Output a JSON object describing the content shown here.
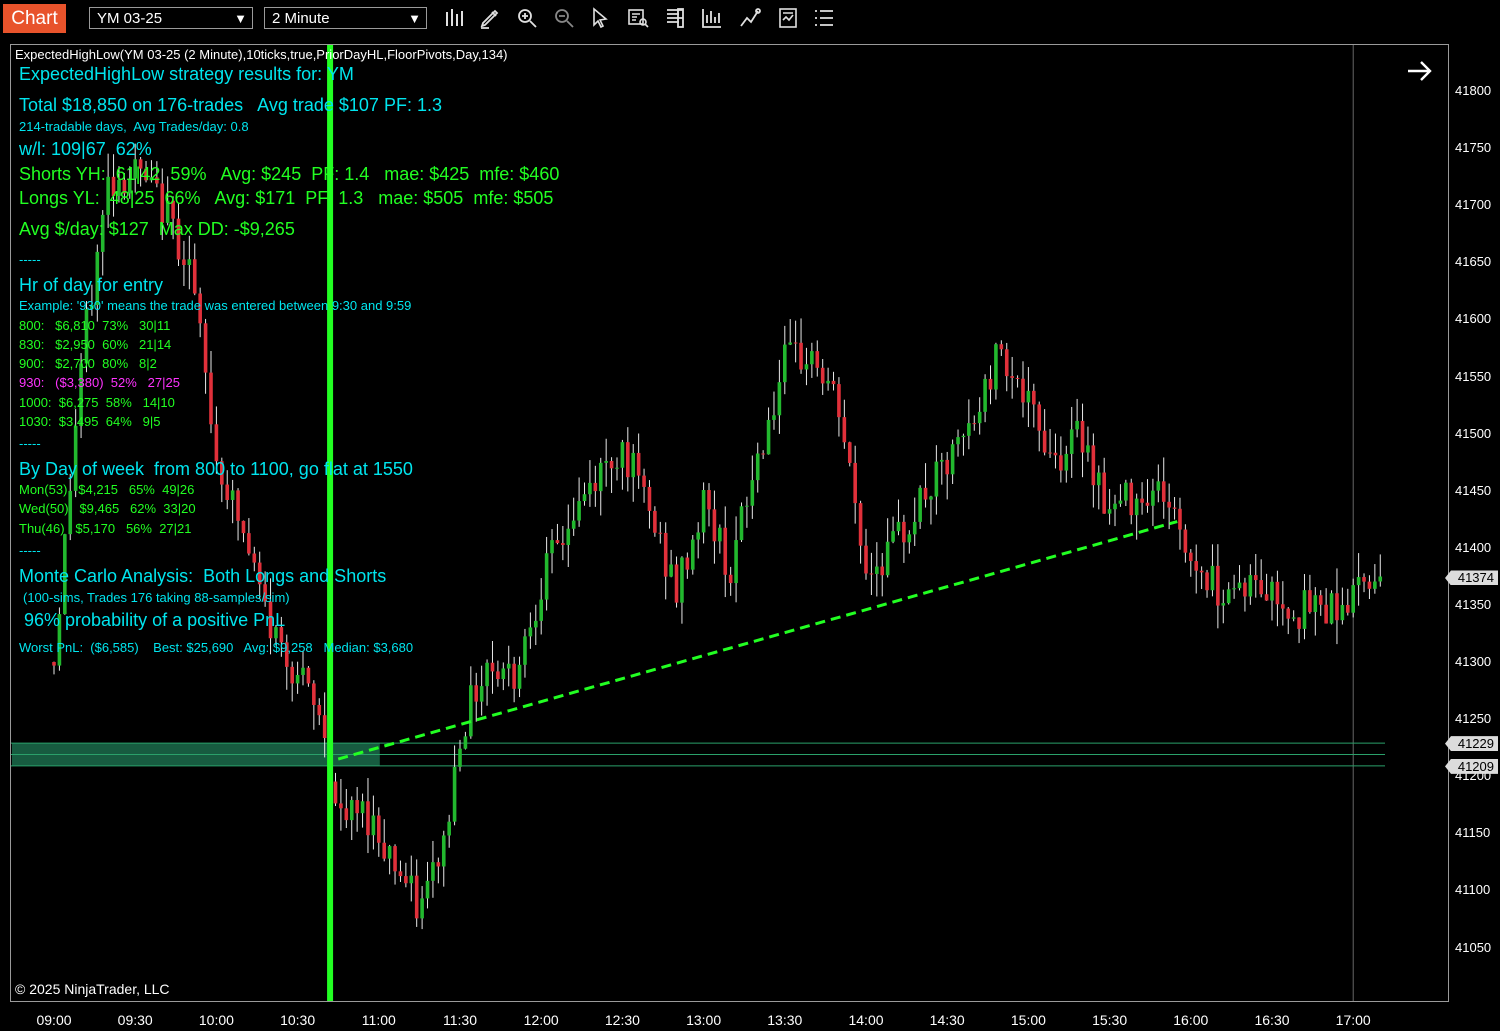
{
  "toolbar": {
    "chart_tab": "Chart",
    "instrument": "YM 03-25",
    "interval": "2 Minute",
    "icons": [
      "bar-type-icon",
      "draw-pencil-icon",
      "zoom-in-icon",
      "zoom-out-icon",
      "pointer-icon",
      "data-box-icon",
      "chart-properties-icon",
      "indicators-icon",
      "strategies-icon",
      "templates-icon",
      "menu-list-icon"
    ]
  },
  "indicator_title": "ExpectedHighLow(YM 03-25 (2 Minute),10ticks,true,PriorDayHL,FloorPivots,Day,134)",
  "results": {
    "header": "ExpectedHighLow strategy results for: YM",
    "total": "Total $18,850 on 176-trades   Avg trade $107 PF: 1.3",
    "days": "214-tradable days,  Avg Trades/day: 0.8",
    "wl": "w/l: 109|67  62%",
    "shorts": "Shorts YH:  61|42  59%   Avg: $245  PF: 1.4   mae: $425  mfe: $460",
    "longs": "Longs YL:  48|25  66%   Avg: $171  PF: 1.3   mae: $505  mfe: $505",
    "avg_day": "Avg $/day: $127  Max DD: -$9,265",
    "sep1": "-----",
    "hr_header": "Hr of day for entry",
    "hr_example": "Example: '930' means the trade was entered between 9:30 and 9:59",
    "hr_rows": [
      "800:   $6,810  73%   30|11",
      "830:   $2,950  60%   21|14",
      "900:   $2,700  80%   8|2",
      "930:   ($3,380)  52%   27|25",
      "1000:  $6,275  58%   14|10",
      "1030:  $3,495  64%   9|5"
    ],
    "sep2": "-----",
    "dow_header": "By Day of week  from 800 to 1100, go flat at 1550",
    "dow_rows": [
      "Mon(53)   $4,215   65%  49|26",
      "Wed(50)   $9,465   62%  33|20",
      "Thu(46)   $5,170   56%  27|21"
    ],
    "sep3": "-----",
    "mc_header": "Monte Carlo Analysis:  Both Longs and Shorts",
    "mc_sub": "(100-sims, Trades 176 taking 88-samples/sim)",
    "mc_prob": "96% probability of a positive PnL",
    "mc_stats": "Worst PnL:  ($6,585)    Best: $25,690   Avg: $9,258   Median: $3,680"
  },
  "copyright": "© 2025 NinjaTrader, LLC",
  "colors": {
    "up": "#22b82e",
    "down": "#e0303a",
    "wick": "#e8e8e8",
    "accent_green": "#22ff22",
    "text_cyan": "#00e5ee",
    "toolbar_tab": "#e8532b"
  },
  "chart_data": {
    "type": "candlestick",
    "instrument": "YM 03-25",
    "interval": "2 Minute",
    "ylim": [
      41010,
      41850
    ],
    "y_ticks": [
      41800,
      41750,
      41700,
      41650,
      41600,
      41550,
      41500,
      41450,
      41400,
      41350,
      41300,
      41250,
      41200,
      41150,
      41100,
      41050
    ],
    "x_ticks": [
      "09:00",
      "09:30",
      "10:00",
      "10:30",
      "11:00",
      "11:30",
      "12:00",
      "12:30",
      "13:00",
      "13:30",
      "14:00",
      "14:30",
      "15:00",
      "15:30",
      "16:00",
      "16:30",
      "17:00"
    ],
    "price_tags": [
      "41374",
      "41229",
      "41209"
    ],
    "horizontal_levels": [
      41229,
      41219,
      41209
    ],
    "trend_line": [
      {
        "t": "10:45",
        "p": 41215
      },
      {
        "t": "15:55",
        "p": 41423
      }
    ],
    "vertical_marker": "10:42",
    "series_path": [
      [
        "09:00",
        41300
      ],
      [
        "09:10",
        41560
      ],
      [
        "09:20",
        41720
      ],
      [
        "09:30",
        41730
      ],
      [
        "09:40",
        41700
      ],
      [
        "09:50",
        41650
      ],
      [
        "10:00",
        41480
      ],
      [
        "10:10",
        41410
      ],
      [
        "10:20",
        41330
      ],
      [
        "10:30",
        41290
      ],
      [
        "10:40",
        41240
      ],
      [
        "10:45",
        41160
      ],
      [
        "10:55",
        41170
      ],
      [
        "11:05",
        41130
      ],
      [
        "11:15",
        41080
      ],
      [
        "11:25",
        41150
      ],
      [
        "11:30",
        41240
      ],
      [
        "11:40",
        41300
      ],
      [
        "11:50",
        41290
      ],
      [
        "12:00",
        41370
      ],
      [
        "12:10",
        41420
      ],
      [
        "12:20",
        41460
      ],
      [
        "12:30",
        41490
      ],
      [
        "12:40",
        41430
      ],
      [
        "12:50",
        41360
      ],
      [
        "13:00",
        41440
      ],
      [
        "13:10",
        41380
      ],
      [
        "13:20",
        41480
      ],
      [
        "13:30",
        41560
      ],
      [
        "13:40",
        41570
      ],
      [
        "13:50",
        41520
      ],
      [
        "14:00",
        41380
      ],
      [
        "14:10",
        41400
      ],
      [
        "14:20",
        41440
      ],
      [
        "14:30",
        41470
      ],
      [
        "14:40",
        41510
      ],
      [
        "14:50",
        41580
      ],
      [
        "15:00",
        41520
      ],
      [
        "15:10",
        41480
      ],
      [
        "15:20",
        41500
      ],
      [
        "15:30",
        41430
      ],
      [
        "15:40",
        41450
      ],
      [
        "15:50",
        41450
      ],
      [
        "16:00",
        41390
      ],
      [
        "16:10",
        41365
      ],
      [
        "16:20",
        41370
      ],
      [
        "16:30",
        41360
      ],
      [
        "16:40",
        41345
      ],
      [
        "16:50",
        41350
      ],
      [
        "17:00",
        41355
      ],
      [
        "17:05",
        41380
      ],
      [
        "17:10",
        41374
      ]
    ]
  }
}
